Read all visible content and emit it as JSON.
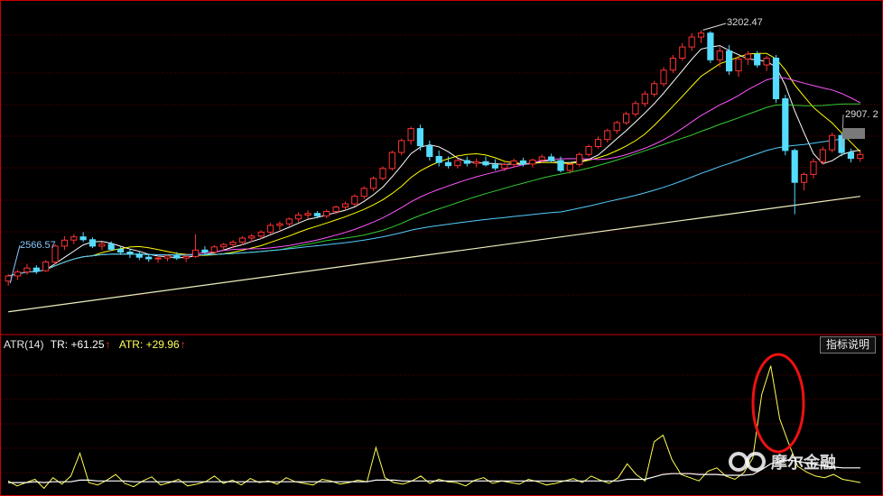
{
  "chart_data": [
    {
      "type": "candlestick",
      "title": "",
      "value_labels": {
        "high": "3202.47",
        "low": "2566.57",
        "last": "2907. 2"
      },
      "high_value": 3202.47,
      "low_value": 2566.57,
      "last_value": 2907.2,
      "ylim": [
        2440,
        3260
      ],
      "grid": true,
      "ohlc": [
        [
          2572,
          2590,
          2560,
          2585
        ],
        [
          2585,
          2600,
          2575,
          2595
        ],
        [
          2595,
          2615,
          2588,
          2605
        ],
        [
          2605,
          2612,
          2590,
          2598
        ],
        [
          2598,
          2625,
          2595,
          2620
        ],
        [
          2620,
          2665,
          2615,
          2660
        ],
        [
          2660,
          2685,
          2650,
          2675
        ],
        [
          2675,
          2690,
          2665,
          2683
        ],
        [
          2683,
          2695,
          2670,
          2676
        ],
        [
          2676,
          2682,
          2655,
          2660
        ],
        [
          2660,
          2670,
          2650,
          2665
        ],
        [
          2665,
          2672,
          2648,
          2652
        ],
        [
          2652,
          2658,
          2638,
          2645
        ],
        [
          2645,
          2652,
          2630,
          2640
        ],
        [
          2640,
          2648,
          2625,
          2632
        ],
        [
          2632,
          2640,
          2620,
          2628
        ],
        [
          2628,
          2636,
          2618,
          2630
        ],
        [
          2630,
          2640,
          2622,
          2635
        ],
        [
          2635,
          2645,
          2625,
          2630
        ],
        [
          2630,
          2640,
          2620,
          2634
        ],
        [
          2634,
          2690,
          2630,
          2650
        ],
        [
          2650,
          2660,
          2638,
          2645
        ],
        [
          2645,
          2662,
          2640,
          2658
        ],
        [
          2658,
          2668,
          2648,
          2664
        ],
        [
          2664,
          2675,
          2655,
          2670
        ],
        [
          2670,
          2685,
          2662,
          2680
        ],
        [
          2680,
          2690,
          2670,
          2685
        ],
        [
          2685,
          2700,
          2678,
          2695
        ],
        [
          2695,
          2718,
          2690,
          2712
        ],
        [
          2712,
          2722,
          2700,
          2716
        ],
        [
          2716,
          2732,
          2710,
          2728
        ],
        [
          2728,
          2745,
          2720,
          2738
        ],
        [
          2738,
          2750,
          2728,
          2742
        ],
        [
          2742,
          2748,
          2730,
          2736
        ],
        [
          2736,
          2752,
          2730,
          2747
        ],
        [
          2747,
          2762,
          2740,
          2758
        ],
        [
          2758,
          2772,
          2750,
          2766
        ],
        [
          2766,
          2790,
          2760,
          2785
        ],
        [
          2785,
          2810,
          2778,
          2805
        ],
        [
          2805,
          2835,
          2798,
          2830
        ],
        [
          2830,
          2860,
          2825,
          2855
        ],
        [
          2855,
          2900,
          2850,
          2895
        ],
        [
          2895,
          2930,
          2888,
          2925
        ],
        [
          2925,
          2960,
          2915,
          2955
        ],
        [
          2955,
          2965,
          2900,
          2912
        ],
        [
          2912,
          2925,
          2875,
          2885
        ],
        [
          2885,
          2900,
          2860,
          2870
        ],
        [
          2870,
          2885,
          2855,
          2862
        ],
        [
          2862,
          2880,
          2855,
          2875
        ],
        [
          2875,
          2885,
          2860,
          2868
        ],
        [
          2868,
          2880,
          2858,
          2872
        ],
        [
          2872,
          2885,
          2860,
          2864
        ],
        [
          2864,
          2878,
          2850,
          2856
        ],
        [
          2856,
          2870,
          2848,
          2865
        ],
        [
          2865,
          2880,
          2858,
          2874
        ],
        [
          2874,
          2882,
          2860,
          2866
        ],
        [
          2866,
          2880,
          2858,
          2876
        ],
        [
          2876,
          2890,
          2868,
          2884
        ],
        [
          2884,
          2892,
          2870,
          2875
        ],
        [
          2875,
          2885,
          2845,
          2850
        ],
        [
          2850,
          2870,
          2842,
          2865
        ],
        [
          2865,
          2895,
          2860,
          2890
        ],
        [
          2890,
          2915,
          2885,
          2910
        ],
        [
          2910,
          2935,
          2905,
          2928
        ],
        [
          2928,
          2955,
          2920,
          2950
        ],
        [
          2950,
          2975,
          2942,
          2970
        ],
        [
          2970,
          2998,
          2965,
          2992
        ],
        [
          2992,
          3025,
          2985,
          3018
        ],
        [
          3018,
          3050,
          3010,
          3042
        ],
        [
          3042,
          3075,
          3035,
          3068
        ],
        [
          3068,
          3110,
          3060,
          3102
        ],
        [
          3102,
          3140,
          3095,
          3132
        ],
        [
          3132,
          3170,
          3125,
          3160
        ],
        [
          3160,
          3195,
          3150,
          3185
        ],
        [
          3185,
          3202,
          3170,
          3195
        ],
        [
          3195,
          3200,
          3120,
          3128
        ],
        [
          3128,
          3160,
          3110,
          3150
        ],
        [
          3150,
          3165,
          3090,
          3100
        ],
        [
          3100,
          3135,
          3085,
          3130
        ],
        [
          3130,
          3150,
          3115,
          3142
        ],
        [
          3142,
          3150,
          3108,
          3115
        ],
        [
          3115,
          3138,
          3100,
          3132
        ],
        [
          3132,
          3140,
          3020,
          3030
        ],
        [
          3030,
          3040,
          2888,
          2900
        ],
        [
          2900,
          2905,
          2740,
          2820
        ],
        [
          2820,
          2845,
          2800,
          2840
        ],
        [
          2840,
          2880,
          2830,
          2872
        ],
        [
          2872,
          2910,
          2865,
          2902
        ],
        [
          2902,
          2945,
          2895,
          2938
        ],
        [
          2938,
          2942,
          2885,
          2895
        ],
        [
          2895,
          2905,
          2870,
          2880
        ],
        [
          2880,
          2900,
          2872,
          2890
        ]
      ],
      "moving_averages": [
        {
          "color": "#ffffff",
          "period": 5
        },
        {
          "color": "#ffff00",
          "period": 10
        },
        {
          "color": "#ff55ff",
          "period": 20
        },
        {
          "color": "#33cc33",
          "period": 30
        },
        {
          "color": "#55ccff",
          "period": 60
        }
      ],
      "long_ma": {
        "color": "#f0f0c0",
        "start": 2495,
        "end": 2785
      }
    },
    {
      "type": "line",
      "title": "ATR(14)",
      "series": [
        {
          "name": "TR",
          "display": "TR: +61.25",
          "color": "#ffffff"
        },
        {
          "name": "ATR",
          "display": "ATR: +29.96",
          "color": "#ffff55"
        }
      ],
      "tr_values": [
        14,
        8,
        12,
        16,
        5,
        18,
        10,
        20,
        48,
        12,
        9,
        15,
        22,
        11,
        7,
        14,
        19,
        9,
        12,
        16,
        8,
        10,
        13,
        20,
        11,
        15,
        9,
        17,
        12,
        14,
        10,
        18,
        13,
        11,
        9,
        16,
        14,
        10,
        12,
        15,
        13,
        55,
        18,
        12,
        10,
        14,
        20,
        11,
        16,
        13,
        12,
        8,
        15,
        18,
        11,
        14,
        12,
        10,
        16,
        13,
        9,
        11,
        14,
        17,
        12,
        20,
        15,
        11,
        18,
        35,
        22,
        14,
        62,
        70,
        40,
        22,
        18,
        14,
        26,
        30,
        20,
        16,
        24,
        42,
        120,
        155,
        90,
        60,
        32,
        25,
        20,
        18,
        22,
        16,
        14,
        12
      ],
      "atr_values": [
        12,
        12,
        12,
        13,
        12,
        13,
        13,
        13,
        15,
        15,
        14,
        14,
        14,
        14,
        13,
        13,
        13,
        13,
        13,
        13,
        13,
        13,
        13,
        13,
        13,
        13,
        13,
        13,
        13,
        13,
        13,
        13,
        13,
        13,
        13,
        13,
        13,
        13,
        13,
        13,
        13,
        15,
        15,
        15,
        14,
        14,
        14,
        14,
        14,
        14,
        14,
        14,
        14,
        14,
        14,
        14,
        14,
        14,
        14,
        14,
        14,
        14,
        14,
        14,
        14,
        14,
        14,
        14,
        14,
        16,
        16,
        16,
        19,
        22,
        23,
        23,
        23,
        22,
        22,
        22,
        21,
        21,
        21,
        22,
        28,
        35,
        38,
        40,
        38,
        36,
        34,
        32,
        31,
        30,
        30,
        30
      ],
      "ylim": [
        0,
        170
      ]
    }
  ],
  "ui": {
    "atr_label": "ATR(14)",
    "tr_label": "TR: +61.25",
    "atr_value_label": "ATR: +29.96",
    "arrow": "↑",
    "explain_button": "指标说明",
    "watermark": "摩尔金融",
    "colors": {
      "up": "#ff3333",
      "down": "#55ddff",
      "frame": "#cc0000",
      "grid": "#660000"
    }
  }
}
